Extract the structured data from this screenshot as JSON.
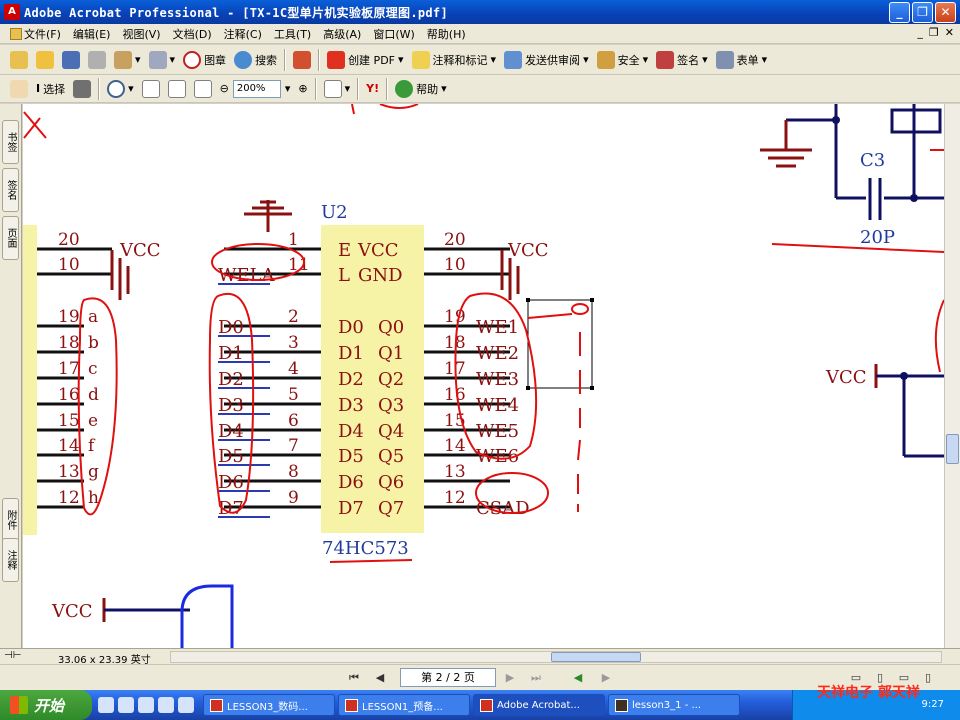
{
  "window": {
    "title": "Adobe Acrobat Professional - [TX-1C型单片机实验板原理图.pdf]"
  },
  "menu": [
    "文件(F)",
    "编辑(E)",
    "视图(V)",
    "文档(D)",
    "注释(C)",
    "工具(T)",
    "高级(A)",
    "窗口(W)",
    "帮助(H)"
  ],
  "toolbar1": {
    "stamp": "图章",
    "search": "搜索",
    "create_pdf": "创建 PDF",
    "comment": "注释和标记",
    "review": "发送供审阅",
    "security": "安全",
    "sign": "签名",
    "forms": "表单"
  },
  "toolbar2": {
    "select": "选择",
    "zoom": "200%",
    "help": "帮助"
  },
  "left_tabs": [
    "书签",
    "签名",
    "页面",
    "附件",
    "注释"
  ],
  "status": {
    "page_size": "33.06 x 23.39 英寸",
    "page_indicator": "第 2 / 2 页"
  },
  "taskbar": {
    "start": "开始",
    "tasks": [
      "LESSON3_数码...",
      "LESSON1_预备...",
      "Adobe Acrobat...",
      "lesson3_1 - ..."
    ],
    "clock": "9:27",
    "watermark": "天祥电子  郭天祥"
  },
  "schematic": {
    "chip_ref": "U2",
    "chip_part": "74HC573",
    "chip_pins_left": [
      "E",
      "L",
      "D0",
      "D1",
      "D2",
      "D3",
      "D4",
      "D5",
      "D6",
      "D7"
    ],
    "chip_pins_right": [
      "VCC",
      "GND",
      "Q0",
      "Q1",
      "Q2",
      "Q3",
      "Q4",
      "Q5",
      "Q6",
      "Q7"
    ],
    "chip_left_pin_numbers": [
      "1",
      "11",
      "2",
      "3",
      "4",
      "5",
      "6",
      "7",
      "8",
      "9"
    ],
    "chip_right_pin_numbers": [
      "20",
      "10",
      "19",
      "18",
      "17",
      "16",
      "15",
      "14",
      "13",
      "12"
    ],
    "left_net_labels": [
      "WELA",
      "D0",
      "D1",
      "D2",
      "D3",
      "D4",
      "D5",
      "D6",
      "D7"
    ],
    "right_net_labels": [
      "WE1",
      "WE2",
      "WE3",
      "WE4",
      "WE5",
      "WE6",
      "",
      "CSAD"
    ],
    "left_chip_pin_numbers": [
      "20",
      "10",
      "19",
      "18",
      "17",
      "16",
      "15",
      "14",
      "13",
      "12"
    ],
    "left_chip_pin_names": [
      "a",
      "b",
      "c",
      "d",
      "e",
      "f",
      "g",
      "h"
    ],
    "vcc": "VCC",
    "cap_ref": "C3",
    "cap_value": "20P"
  }
}
